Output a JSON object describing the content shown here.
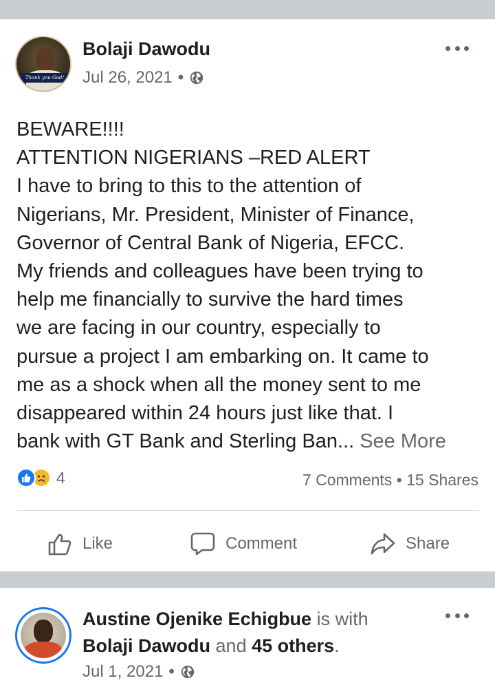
{
  "post1": {
    "author": "Bolaji Dawodu",
    "avatar_banner": "Thank you God!",
    "date": "Jul 26, 2021",
    "separator": "•",
    "privacy_icon": "globe-icon",
    "body_lines": [
      "BEWARE!!!!",
      "ATTENTION NIGERIANS –RED ALERT",
      "I have to bring to this to the attention of",
      "Nigerians, Mr. President, Minister of Finance,",
      "Governor of Central Bank of Nigeria, EFCC.",
      "My friends and colleagues have been trying to",
      "help me financially to survive the hard times",
      "we are facing in our country, especially to",
      "pursue a project I am embarking on. It came to",
      "me as a shock when all the money sent to me",
      "disappeared within 24 hours just like that. I"
    ],
    "body_last_line": "bank with GT Bank and Sterling Ban...",
    "see_more": "See More",
    "reactions_count": "4",
    "comments_shares": "7 Comments • 15 Shares",
    "actions": {
      "like": "Like",
      "comment": "Comment",
      "share": "Share"
    }
  },
  "post2": {
    "author": "Austine Ojenike Echigbue",
    "is_with": "is with",
    "tagged": "Bolaji Dawodu",
    "and": "and",
    "others": "45 others",
    "period": ".",
    "date": "Jul 1, 2021",
    "separator": "•",
    "privacy_icon": "globe-icon"
  },
  "colors": {
    "separator_bg": "#c9ccd1",
    "secondary_text": "#65676b",
    "like_blue": "#1877f2",
    "sad_yellow": "#f7b928"
  }
}
